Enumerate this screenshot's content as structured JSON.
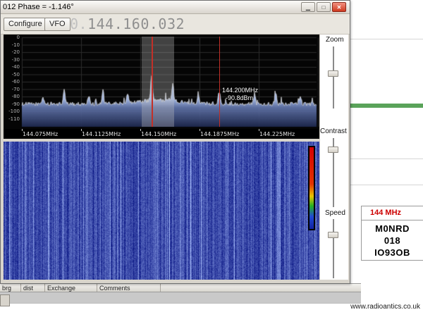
{
  "sdr_window": {
    "title": "012 Phase = -1.146°",
    "window_icons": {
      "minimize": "▁",
      "maximize": "□",
      "close": "✕"
    },
    "toolbar": {
      "configure": "Configure",
      "vfo": "VFO",
      "frequency_prefix": "0.",
      "frequency_main": "144.160.032"
    },
    "spectrum": {
      "db_labels": [
        "0",
        "-10",
        "-20",
        "-30",
        "-40",
        "-50",
        "-60",
        "-70",
        "-80",
        "-90",
        "-100",
        "-110"
      ],
      "freq_labels": [
        "144.075MHz",
        "144.1125MHz",
        "144.150MHz",
        "144.1875MHz",
        "144.225MHz"
      ],
      "cursor_freq": "144.200MHz",
      "cursor_level": "-90.8dBm"
    },
    "controls": {
      "zoom": "Zoom",
      "contrast": "Contrast",
      "speed": "Speed"
    }
  },
  "logger": {
    "band": "144 MHz",
    "callsign": "M0NRD",
    "serial": "018",
    "locator": "IO93OB",
    "columns": [
      "brg",
      "dist",
      "Exchange",
      "Comments"
    ],
    "website": "www.radioantics.co.uk"
  },
  "colors": {
    "marker_red": "#c23028",
    "band_text_red": "#cc0000",
    "meter_green": "#5aa35a",
    "waterfall_base": "#1030c0"
  }
}
